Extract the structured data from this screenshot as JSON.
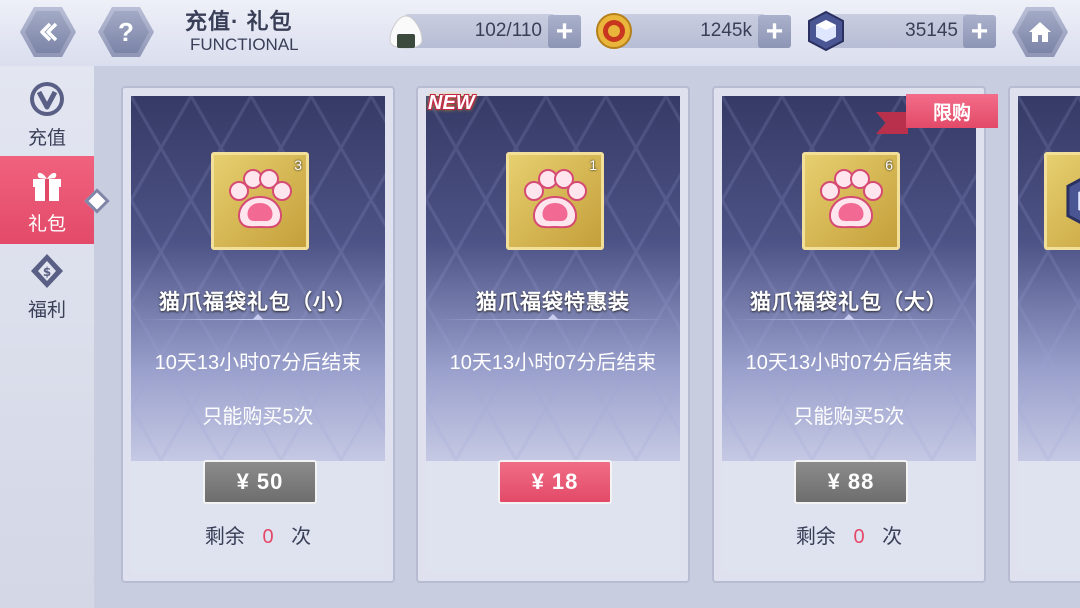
{
  "header": {
    "title": "充值· 礼包",
    "subtitle": "FUNCTIONAL",
    "back_icon": "back-arrow-icon",
    "help_label": "?",
    "home_icon": "home-icon"
  },
  "resources": [
    {
      "name": "stamina",
      "icon": "onigiri-icon",
      "value": "102/110"
    },
    {
      "name": "gold",
      "icon": "coin-icon",
      "value": "1245k"
    },
    {
      "name": "crystal",
      "icon": "crystal-icon",
      "value": "35145"
    }
  ],
  "plus_label": "+",
  "sidebar": {
    "items": [
      {
        "label": "充值",
        "icon": "vip-icon"
      },
      {
        "label": "礼包",
        "icon": "gift-icon"
      },
      {
        "label": "福利",
        "icon": "welfare-icon"
      }
    ]
  },
  "cards": [
    {
      "name": "猫爪福袋礼包（小）",
      "count": "3",
      "timer": "10天13小时07分后结束",
      "limit": "只能购买5次",
      "price": "¥ 50",
      "remain_prefix": "剩余",
      "remain_num": "0",
      "remain_suffix": "次"
    },
    {
      "name": "猫爪福袋特惠装",
      "count": "1",
      "timer": "10天13小时07分后结束",
      "limit": "",
      "price": "¥ 18",
      "tag": "NEW"
    },
    {
      "name": "猫爪福袋礼包（大）",
      "count": "6",
      "timer": "10天13小时07分后结束",
      "limit": "只能购买5次",
      "price": "¥ 88",
      "remain_prefix": "剩余",
      "remain_num": "0",
      "remain_suffix": "次",
      "tag": "限购"
    }
  ],
  "colors": {
    "accent": "#e24a68",
    "card_dark": "#363a66",
    "button_gray": "#7c7c7c",
    "frame_gold": "#d6b24f"
  }
}
